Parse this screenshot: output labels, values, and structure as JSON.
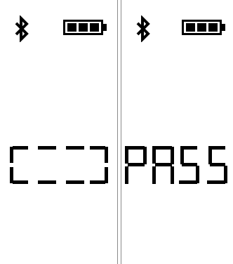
{
  "screens": [
    {
      "bluetooth_icon": "bluetooth-icon",
      "battery_icon": "battery-full-icon",
      "display_text": "[---]"
    },
    {
      "bluetooth_icon": "bluetooth-icon",
      "battery_icon": "battery-full-icon",
      "display_text": "PASS"
    }
  ]
}
